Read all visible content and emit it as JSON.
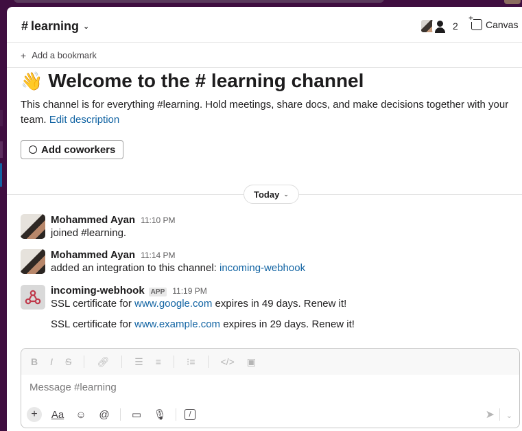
{
  "header": {
    "hash": "#",
    "channel_name": "learning",
    "member_count": "2",
    "canvas_label": "Canvas"
  },
  "bookmark": {
    "label": "Add a bookmark"
  },
  "welcome": {
    "title": "Welcome to the # learning channel",
    "description": "This channel is for everything #learning. Hold meetings, share docs, and make decisions together with your team.",
    "edit_link": "Edit description",
    "add_coworkers_label": "Add coworkers"
  },
  "divider": {
    "label": "Today"
  },
  "messages": [
    {
      "author": "Mohammed Ayan",
      "time": "11:10 PM",
      "text": "joined #learning."
    },
    {
      "author": "Mohammed Ayan",
      "time": "11:14 PM",
      "text": "added an integration to this channel: ",
      "link": "incoming-webhook"
    },
    {
      "author": "incoming-webhook",
      "tag": "APP",
      "time": "11:19 PM",
      "lines": [
        {
          "prefix": "SSL certificate for ",
          "link": "www.google.com",
          "suffix": " expires in 49 days. Renew it!"
        },
        {
          "prefix": "SSL certificate for ",
          "link": "www.example.com",
          "suffix": " expires in 29 days. Renew it!"
        }
      ]
    }
  ],
  "composer": {
    "placeholder": "Message #learning",
    "format_buttons": [
      "B",
      "I",
      "S",
      "link",
      "ordered-list",
      "bulleted-list",
      "blockquote",
      "code",
      "code-block"
    ],
    "bottom_icons": [
      "plus-icon",
      "text-format-icon",
      "emoji-icon",
      "mention-icon",
      "video-icon",
      "microphone-icon",
      "slash-command-icon",
      "send-icon"
    ],
    "format_label": "Aa"
  }
}
